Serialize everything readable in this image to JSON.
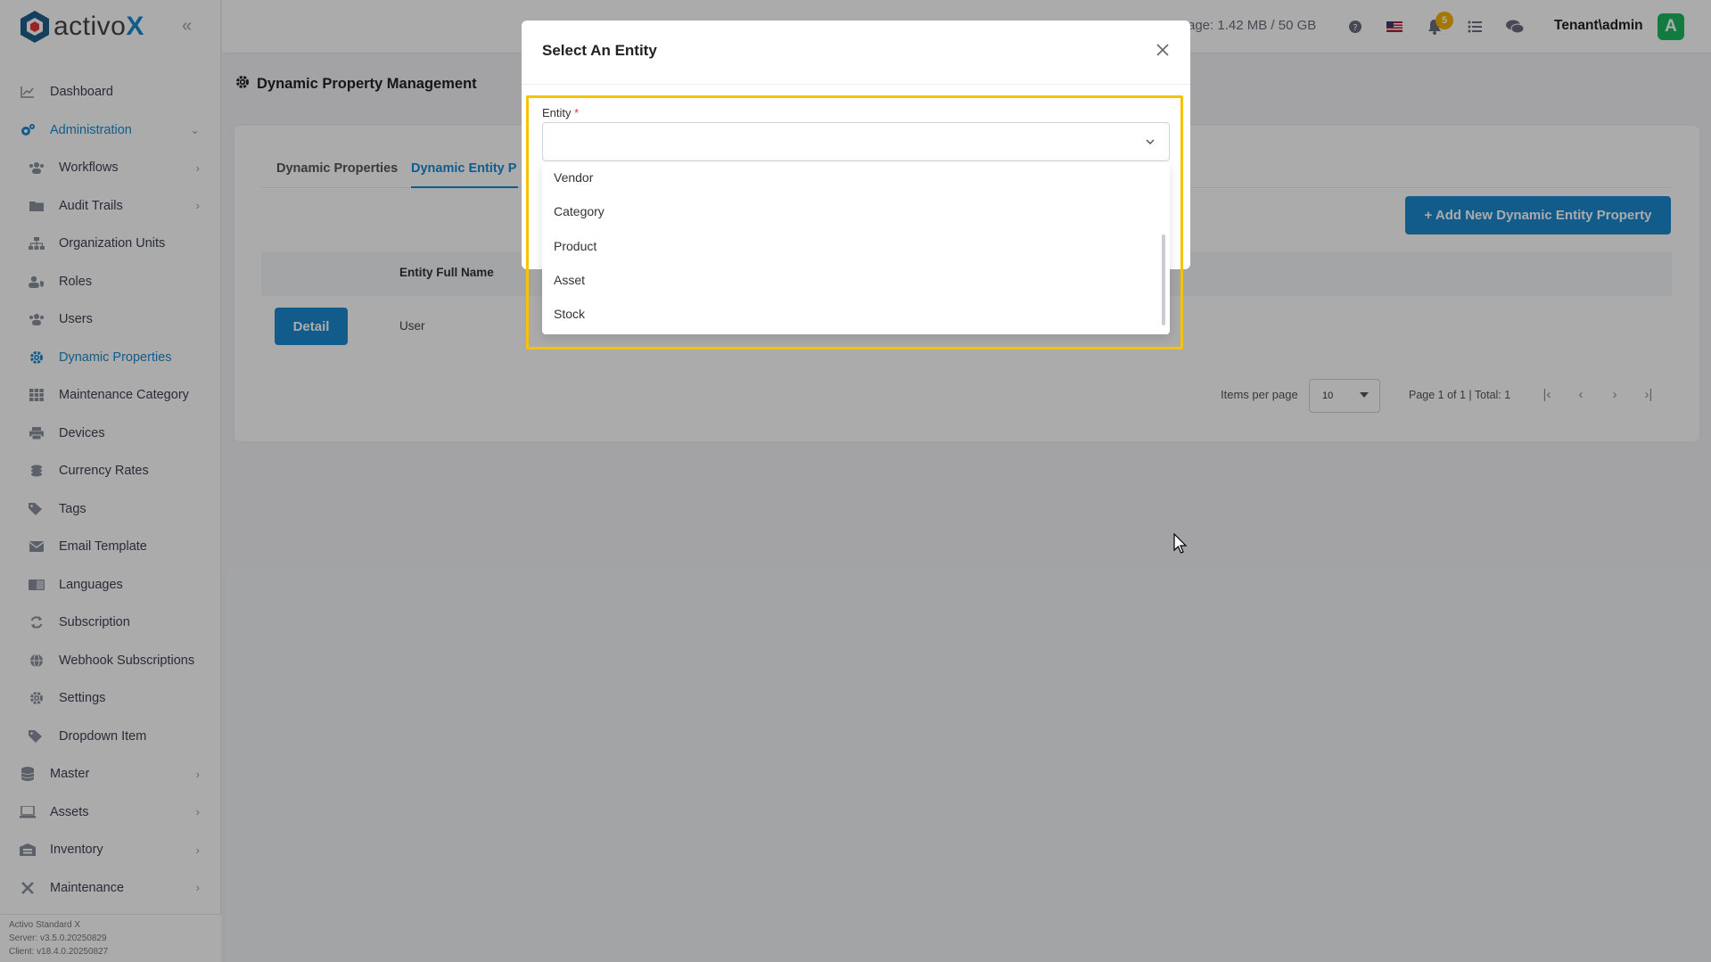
{
  "app": {
    "logo_text_main": "activo",
    "logo_text_accent": "X",
    "footer_line1": "Activo Standard X",
    "footer_line2": "Server: v3.5.0.20250829",
    "footer_line3": "Client: v18.4.0.20250827"
  },
  "sidebar": {
    "items": [
      {
        "label": "Dashboard",
        "icon": "chart-line-icon"
      },
      {
        "label": "Administration",
        "icon": "cogs-icon"
      },
      {
        "label": "Workflows",
        "icon": "users-icon"
      },
      {
        "label": "Audit Trails",
        "icon": "folder-icon"
      },
      {
        "label": "Organization Units",
        "icon": "sitemap-icon"
      },
      {
        "label": "Roles",
        "icon": "user-shield-icon"
      },
      {
        "label": "Users",
        "icon": "users-icon"
      },
      {
        "label": "Dynamic Properties",
        "icon": "gear-icon"
      },
      {
        "label": "Maintenance Category",
        "icon": "grid-icon"
      },
      {
        "label": "Devices",
        "icon": "printer-icon"
      },
      {
        "label": "Currency Rates",
        "icon": "coins-icon"
      },
      {
        "label": "Tags",
        "icon": "tags-icon"
      },
      {
        "label": "Email Template",
        "icon": "envelope-icon"
      },
      {
        "label": "Languages",
        "icon": "language-icon"
      },
      {
        "label": "Subscription",
        "icon": "refresh-icon"
      },
      {
        "label": "Webhook Subscriptions",
        "icon": "globe-icon"
      },
      {
        "label": "Settings",
        "icon": "gear-icon"
      },
      {
        "label": "Dropdown Item",
        "icon": "tags-icon"
      },
      {
        "label": "Master",
        "icon": "database-icon"
      },
      {
        "label": "Assets",
        "icon": "laptop-icon"
      },
      {
        "label": "Inventory",
        "icon": "warehouse-icon"
      },
      {
        "label": "Maintenance",
        "icon": "tools-icon"
      }
    ]
  },
  "topbar": {
    "usage": "age: 1.42 MB / 50 GB",
    "notification_count": "5",
    "user": "Tenant\\admin",
    "avatar_letter": "A"
  },
  "page": {
    "title": "Dynamic Property Management",
    "tabs": [
      "Dynamic Properties",
      "Dynamic Entity P"
    ],
    "add_button": "+ Add New Dynamic Entity Property",
    "table_header": "Entity Full Name",
    "row_button": "Detail",
    "row_value": "User",
    "items_per_page_label": "Items per page",
    "items_per_page": "10",
    "page_info": "Page 1 of 1 | Total: 1"
  },
  "modal": {
    "title": "Select An Entity",
    "field_label": "Entity",
    "required_mark": "*",
    "options": [
      "Vendor",
      "Category",
      "Product",
      "Asset",
      "Stock"
    ]
  },
  "colors": {
    "accent": "#1a8ad0",
    "highlight": "#f5c400",
    "avatar": "#1bb85e",
    "badge": "#f5b400"
  }
}
